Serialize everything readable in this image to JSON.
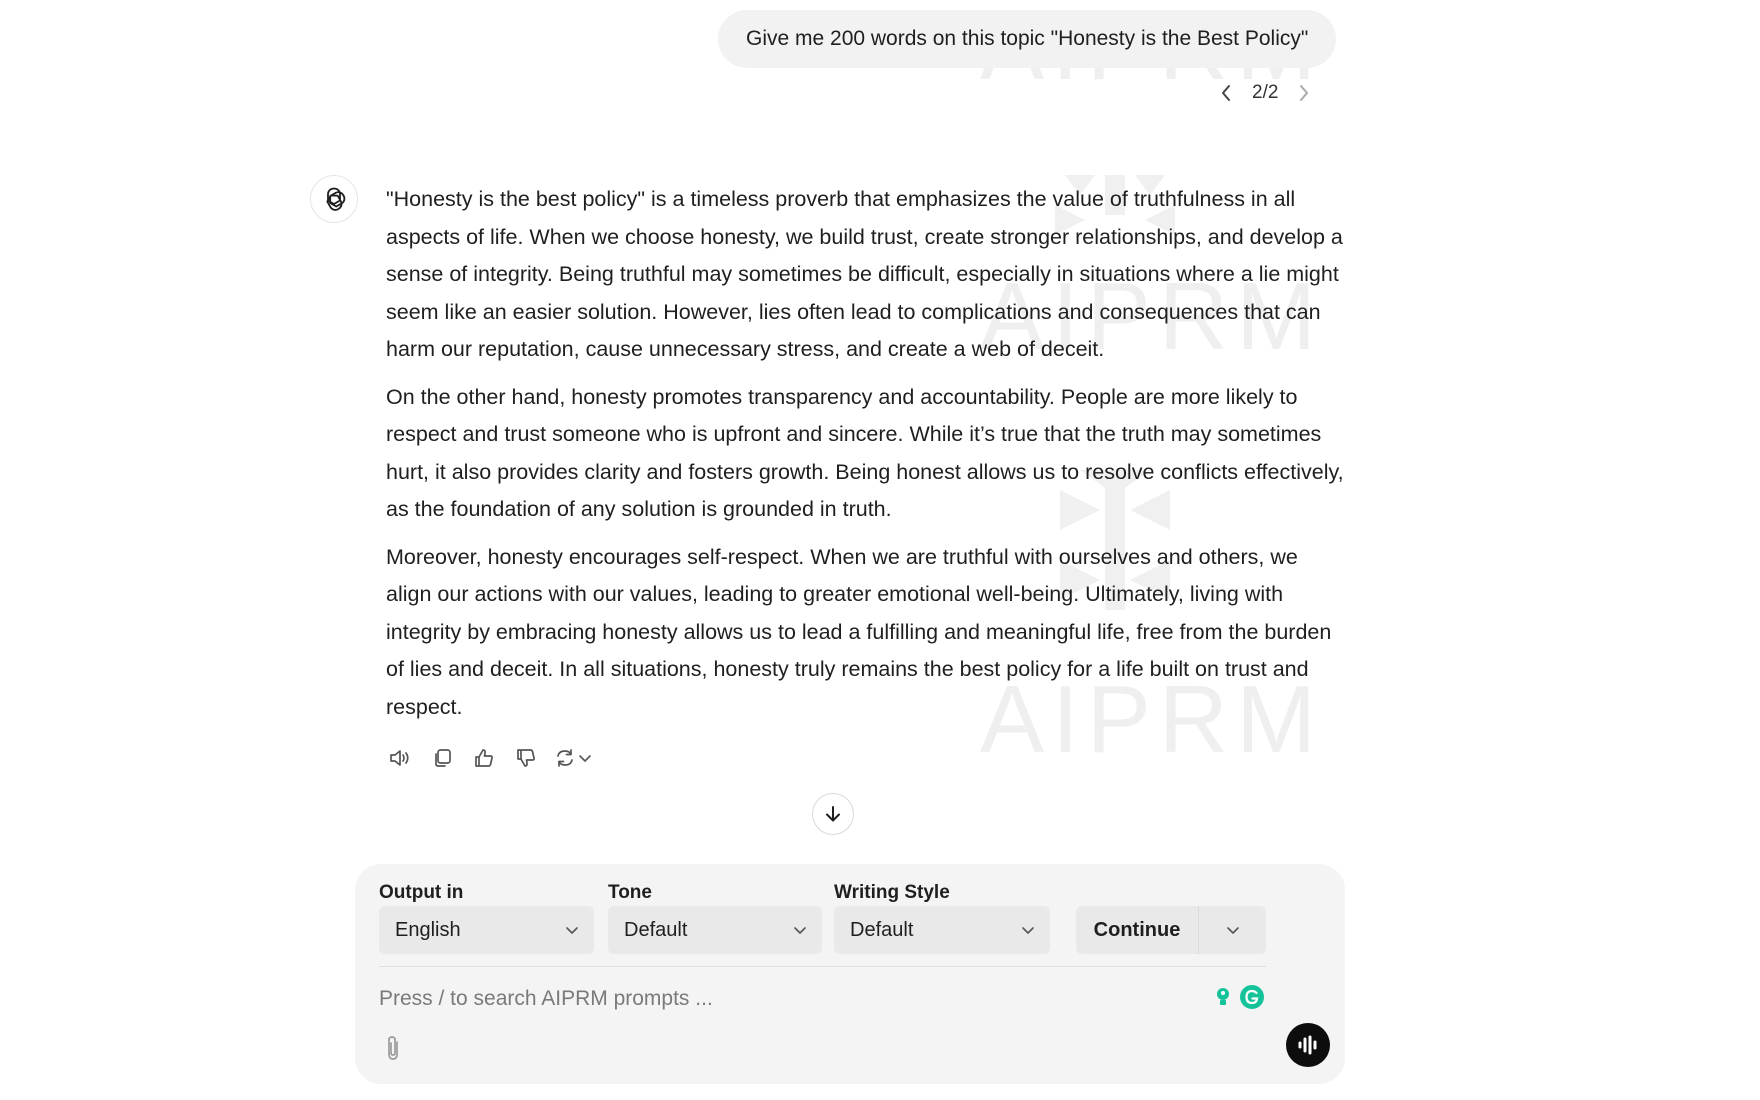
{
  "watermark": {
    "text": "AIPRM"
  },
  "user_message": {
    "text": "Give me 200 words on this topic \"Honesty is the Best Policy\"",
    "pager": "2/2"
  },
  "assistant": {
    "icon": "openai-logo-icon",
    "paragraphs": [
      "\"Honesty is the best policy\" is a timeless proverb that emphasizes the value of truthfulness in all aspects of life. When we choose honesty, we build trust, create stronger relationships, and develop a sense of integrity. Being truthful may sometimes be difficult, especially in situations where a lie might seem like an easier solution. However, lies often lead to complications and consequences that can harm our reputation, cause unnecessary stress, and create a web of deceit.",
      "On the other hand, honesty promotes transparency and accountability. People are more likely to respect and trust someone who is upfront and sincere. While it’s true that the truth may sometimes hurt, it also provides clarity and fosters growth. Being honest allows us to resolve conflicts effectively, as the foundation of any solution is grounded in truth.",
      "Moreover, honesty encourages self-respect. When we are truthful with ourselves and others, we align our actions with our values, leading to greater emotional well-being. Ultimately, living with integrity by embracing honesty allows us to lead a fulfilling and meaningful life, free from the burden of lies and deceit. In all situations, honesty truly remains the best policy for a life built on trust and respect."
    ],
    "actions": [
      "read-aloud-icon",
      "copy-icon",
      "thumbs-up-icon",
      "thumbs-down-icon",
      "regenerate-icon"
    ]
  },
  "composer": {
    "output_label": "Output in",
    "output_value": "English",
    "tone_label": "Tone",
    "tone_value": "Default",
    "style_label": "Writing Style",
    "style_value": "Default",
    "continue_label": "Continue",
    "placeholder": "Press / to search AIPRM prompts ...",
    "accent_colors": {
      "grammarly": "#15c39a",
      "voice_button": "#0d0d0d"
    }
  }
}
